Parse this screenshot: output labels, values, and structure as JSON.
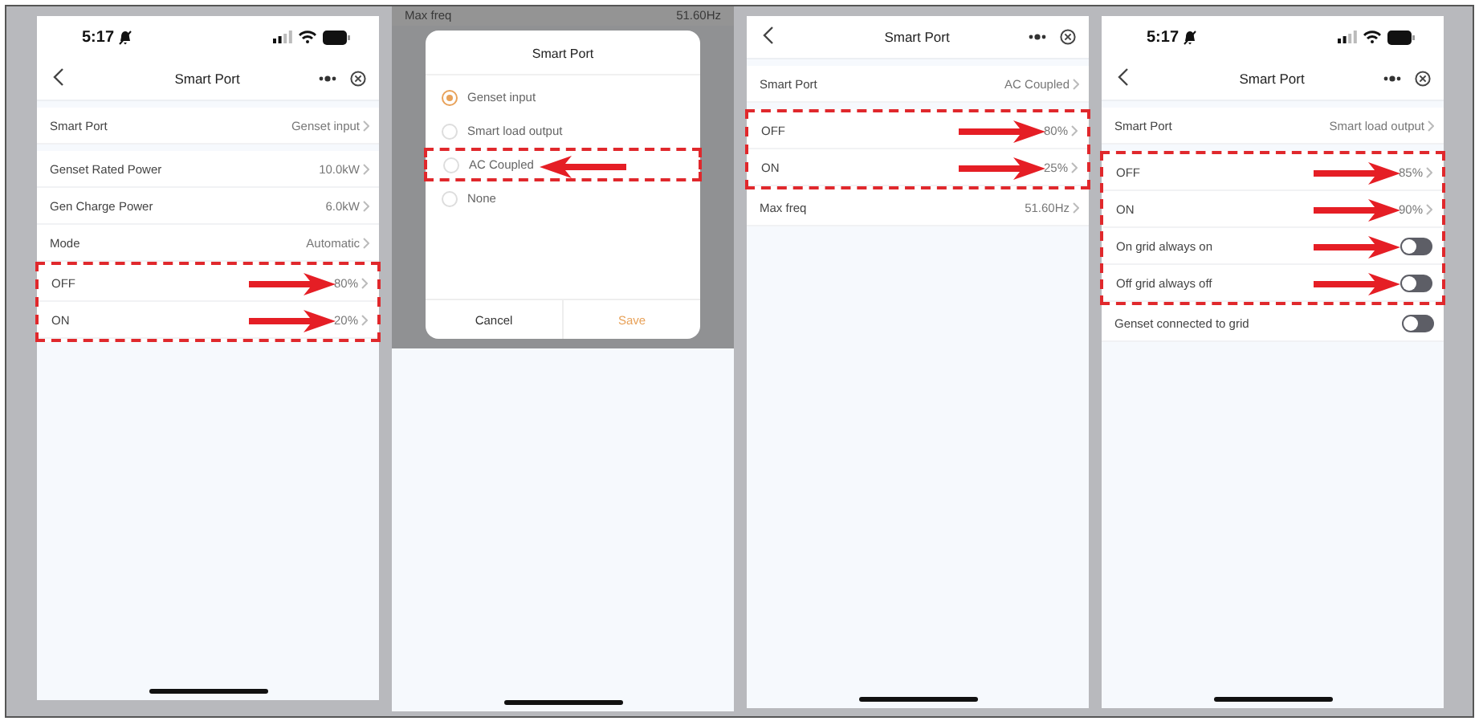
{
  "panels": [
    {
      "kind": "settings",
      "status_bar": {
        "time": "5:17"
      },
      "title": "Smart Port",
      "sections": [
        {
          "rows": [
            {
              "label": "Smart Port",
              "value": "Genset input",
              "kind": "value",
              "annotated": false
            }
          ]
        },
        {
          "rows": [
            {
              "label": "Genset Rated Power",
              "value": "10.0kW",
              "kind": "value",
              "annotated": false
            },
            {
              "label": "Gen Charge Power",
              "value": "6.0kW",
              "kind": "value",
              "annotated": false
            },
            {
              "label": "Mode",
              "value": "Automatic",
              "kind": "value",
              "annotated": false
            },
            {
              "label": "OFF",
              "value": "80%",
              "kind": "value",
              "annotated": true
            },
            {
              "label": "ON",
              "value": "20%",
              "kind": "value",
              "annotated": true
            }
          ]
        }
      ]
    },
    {
      "kind": "dialog",
      "background_row": {
        "label": "Max freq",
        "value": "51.60Hz"
      },
      "dialog": {
        "title": "Smart Port",
        "options": [
          {
            "label": "Genset input",
            "selected": true,
            "annotated": false
          },
          {
            "label": "Smart load output",
            "selected": false,
            "annotated": false
          },
          {
            "label": "AC Coupled",
            "selected": false,
            "annotated": true
          },
          {
            "label": "None",
            "selected": false,
            "annotated": false
          }
        ],
        "buttons": [
          {
            "label": "Cancel",
            "kind": "cancel"
          },
          {
            "label": "Save",
            "kind": "primary"
          }
        ]
      }
    },
    {
      "kind": "settings",
      "title": "Smart Port",
      "sections": [
        {
          "rows": [
            {
              "label": "Smart Port",
              "value": "AC Coupled",
              "kind": "value",
              "annotated": false
            }
          ]
        },
        {
          "rows": [
            {
              "label": "OFF",
              "value": "80%",
              "kind": "value",
              "annotated": true
            },
            {
              "label": "ON",
              "value": "25%",
              "kind": "value",
              "annotated": true
            },
            {
              "label": "Max freq",
              "value": "51.60Hz",
              "kind": "value",
              "annotated": false
            }
          ]
        }
      ]
    },
    {
      "kind": "settings",
      "status_bar": {
        "time": "5:17"
      },
      "title": "Smart Port",
      "sections": [
        {
          "rows": [
            {
              "label": "Smart Port",
              "value": "Smart load output",
              "kind": "value",
              "annotated": false
            }
          ]
        },
        {
          "rows": [
            {
              "label": "OFF",
              "value": "85%",
              "kind": "value",
              "annotated": true
            },
            {
              "label": "ON",
              "value": "90%",
              "kind": "value",
              "annotated": true
            },
            {
              "label": "On grid always on",
              "kind": "toggle",
              "on": false,
              "annotated": true
            },
            {
              "label": "Off grid always off",
              "kind": "toggle",
              "on": false,
              "annotated": true
            },
            {
              "label": "Genset connected to grid",
              "kind": "toggle",
              "on": false,
              "annotated": false
            }
          ]
        }
      ]
    }
  ]
}
